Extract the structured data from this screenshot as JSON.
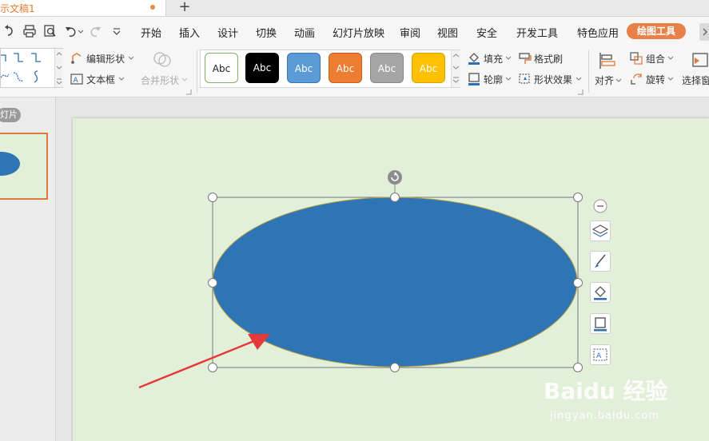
{
  "tabbar": {
    "doc_title": "示文稿1",
    "new_tab": "+"
  },
  "menu": {
    "items": [
      "开始",
      "插入",
      "设计",
      "切换",
      "动画",
      "幻灯片放映",
      "审阅",
      "视图",
      "安全",
      "开发工具",
      "特色应用"
    ],
    "active_tab": "绘图工具"
  },
  "ribbon": {
    "edit_shape": "编辑形状",
    "text_box": "文本框",
    "merge_shapes": "合并形状",
    "style_presets": [
      "Abc",
      "Abc",
      "Abc",
      "Abc",
      "Abc",
      "Abc"
    ],
    "fill": "填充",
    "format_painter": "格式刷",
    "outline": "轮廓",
    "shape_effects": "形状效果",
    "align": "对齐",
    "group": "组合",
    "rotate": "旋转",
    "selection_pane": "选择窗"
  },
  "panel": {
    "slide_badge": "灯片"
  },
  "slide": {
    "shape_type": "ellipse",
    "shape_fill": "#2e75b6",
    "shape_outline": "#b8a044",
    "background": "#e2efd9",
    "annotation_arrow_color": "#e63a3a"
  },
  "watermark": {
    "logo": "Baidu 经验",
    "url": "jingyan.baidu.com"
  },
  "colors": {
    "accent": "#e8804a",
    "ribbon_bg": "#f6f6f6",
    "workspace_bg": "#e6e6e6"
  }
}
